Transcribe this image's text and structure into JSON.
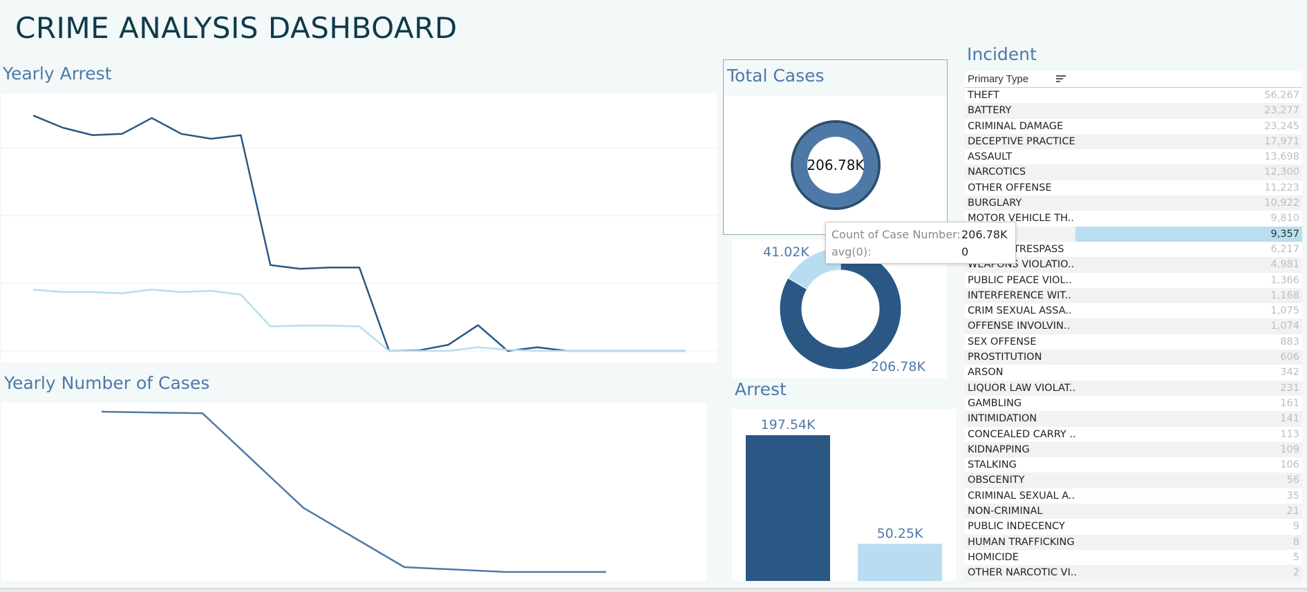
{
  "dashboard": {
    "title": "CRIME ANALYSIS DASHBOARD"
  },
  "colors": {
    "dark": "#2a5783",
    "mid": "#4e79a7",
    "light": "#b9ddf0",
    "title": "#0e3a4c"
  },
  "yearly_arrest": {
    "title": "Yearly Arrest",
    "chart_data": {
      "type": "line",
      "series": [
        {
          "color": "dark",
          "values": [
            0.96,
            0.91,
            0.88,
            0.885,
            0.95,
            0.885,
            0.865,
            0.88,
            0.35,
            0.335,
            0.34,
            0.34,
            0.0,
            0.002,
            0.025,
            0.105,
            0.0,
            0.015,
            0.0,
            0.0,
            0.0,
            0.0,
            0.0
          ]
        },
        {
          "color": "light",
          "values": [
            0.25,
            0.24,
            0.24,
            0.235,
            0.25,
            0.24,
            0.245,
            0.23,
            0.1,
            0.103,
            0.103,
            0.1,
            0.0,
            0.0,
            0.0,
            0.015,
            0.005,
            0.0,
            0.0,
            0.0,
            0.0,
            0.0,
            0.0
          ]
        }
      ]
    }
  },
  "yearly_cases": {
    "title": "Yearly Number of Cases",
    "chart_data": {
      "type": "line",
      "series": [
        {
          "color": "mid",
          "values": [
            1.0,
            0.99,
            0.4,
            0.03,
            0.0,
            0.0
          ]
        }
      ]
    }
  },
  "total_cases": {
    "title": "Total Cases",
    "value": "206.78K"
  },
  "arrest_split": {
    "chart_data": {
      "type": "pie",
      "slices": [
        {
          "label": "41.02K",
          "value": 41.02,
          "color": "light"
        },
        {
          "label": "206.78K",
          "value": 206.78,
          "color": "dark"
        }
      ]
    }
  },
  "arrest": {
    "title": "Arrest",
    "chart_data": {
      "type": "bar",
      "values": [
        197.54,
        50.25
      ],
      "labels": [
        "197.54K",
        "50.25K"
      ],
      "colors": [
        "dark",
        "light"
      ]
    }
  },
  "tooltip": {
    "rows": [
      {
        "key": "Count of Case Number:",
        "value": "206.78K"
      },
      {
        "key": "avg(0):",
        "value": "0"
      }
    ]
  },
  "incident": {
    "title": "Incident",
    "header": "Primary Type",
    "rows": [
      {
        "label": "THEFT",
        "value": "56,267"
      },
      {
        "label": "BATTERY",
        "value": "23,277"
      },
      {
        "label": "CRIMINAL DAMAGE",
        "value": "23,245"
      },
      {
        "label": "DECEPTIVE PRACTICE",
        "value": "17,971"
      },
      {
        "label": "ASSAULT",
        "value": "13,698"
      },
      {
        "label": "NARCOTICS",
        "value": "12,300"
      },
      {
        "label": "OTHER OFFENSE",
        "value": "11,223"
      },
      {
        "label": "BURGLARY",
        "value": "10,922"
      },
      {
        "label": "MOTOR VEHICLE TH..",
        "value": "9,810"
      },
      {
        "label": "",
        "value": "9,357"
      },
      {
        "label": "TRESPASS",
        "value": "6,217"
      },
      {
        "label": "WEAPONS VIOLATIO..",
        "value": "4,981"
      },
      {
        "label": "PUBLIC PEACE VIOL..",
        "value": "1,366"
      },
      {
        "label": "INTERFERENCE WIT..",
        "value": "1,168"
      },
      {
        "label": "CRIM SEXUAL ASSA..",
        "value": "1,075"
      },
      {
        "label": "OFFENSE INVOLVIN..",
        "value": "1,074"
      },
      {
        "label": "SEX OFFENSE",
        "value": "883"
      },
      {
        "label": "PROSTITUTION",
        "value": "606"
      },
      {
        "label": "ARSON",
        "value": "342"
      },
      {
        "label": "LIQUOR LAW VIOLAT..",
        "value": "231"
      },
      {
        "label": "GAMBLING",
        "value": "161"
      },
      {
        "label": "INTIMIDATION",
        "value": "141"
      },
      {
        "label": "CONCEALED CARRY ..",
        "value": "113"
      },
      {
        "label": "KIDNAPPING",
        "value": "109"
      },
      {
        "label": "STALKING",
        "value": "106"
      },
      {
        "label": "OBSCENITY",
        "value": "56"
      },
      {
        "label": "CRIMINAL SEXUAL A..",
        "value": "35"
      },
      {
        "label": "NON-CRIMINAL",
        "value": "21"
      },
      {
        "label": "PUBLIC INDECENCY",
        "value": "9"
      },
      {
        "label": "HUMAN TRAFFICKING",
        "value": "8"
      },
      {
        "label": "HOMICIDE",
        "value": "5"
      },
      {
        "label": "OTHER NARCOTIC VI..",
        "value": "2"
      }
    ]
  }
}
